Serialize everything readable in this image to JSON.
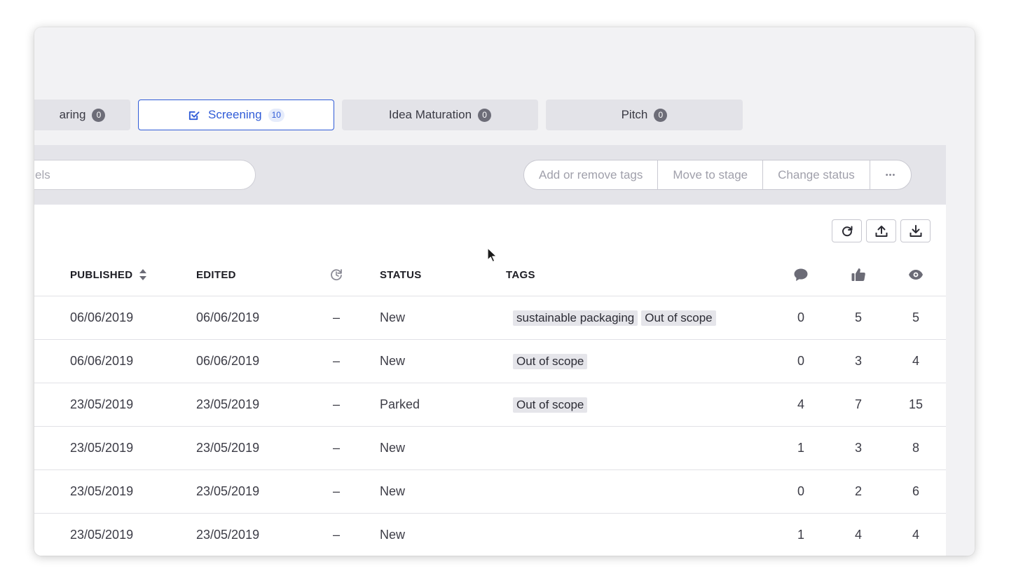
{
  "stages": [
    {
      "label": "aring",
      "count": "0"
    },
    {
      "label": "Screening",
      "count": "10",
      "active": true
    },
    {
      "label": "Idea Maturation",
      "count": "0"
    },
    {
      "label": "Pitch",
      "count": "0"
    }
  ],
  "toolbar": {
    "search_placeholder": "els",
    "add_tags": "Add or remove tags",
    "move_stage": "Move to stage",
    "change_status": "Change status",
    "more": "•••"
  },
  "table": {
    "headers": {
      "published": "PUBLISHED",
      "edited": "EDITED",
      "status": "STATUS",
      "tags": "TAGS"
    },
    "rows": [
      {
        "published": "06/06/2019",
        "edited": "06/06/2019",
        "cycle": "–",
        "status": "New",
        "tags": [
          "sustainable packaging",
          "Out of scope"
        ],
        "comments": "0",
        "likes": "5",
        "views": "5"
      },
      {
        "published": "06/06/2019",
        "edited": "06/06/2019",
        "cycle": "–",
        "status": "New",
        "tags": [
          "Out of scope"
        ],
        "comments": "0",
        "likes": "3",
        "views": "4"
      },
      {
        "published": "23/05/2019",
        "edited": "23/05/2019",
        "cycle": "–",
        "status": "Parked",
        "tags": [
          "Out of scope"
        ],
        "comments": "4",
        "likes": "7",
        "views": "15"
      },
      {
        "published": "23/05/2019",
        "edited": "23/05/2019",
        "cycle": "–",
        "status": "New",
        "tags": [],
        "comments": "1",
        "likes": "3",
        "views": "8"
      },
      {
        "published": "23/05/2019",
        "edited": "23/05/2019",
        "cycle": "–",
        "status": "New",
        "tags": [],
        "comments": "0",
        "likes": "2",
        "views": "6"
      },
      {
        "published": "23/05/2019",
        "edited": "23/05/2019",
        "cycle": "–",
        "status": "New",
        "tags": [],
        "comments": "1",
        "likes": "4",
        "views": "4"
      }
    ]
  },
  "icons": {
    "refresh": "refresh-icon",
    "export": "upload-icon",
    "import": "download-icon",
    "cycle": "cycle-icon",
    "comments": "comment-icon",
    "likes": "thumbs-up-icon",
    "views": "eye-icon",
    "sort": "sort-icon",
    "check": "checkbox-icon"
  },
  "colors": {
    "accent": "#2f5bd7",
    "badge": "#6d6d78",
    "toolbar_bg": "#e4e4e9"
  }
}
